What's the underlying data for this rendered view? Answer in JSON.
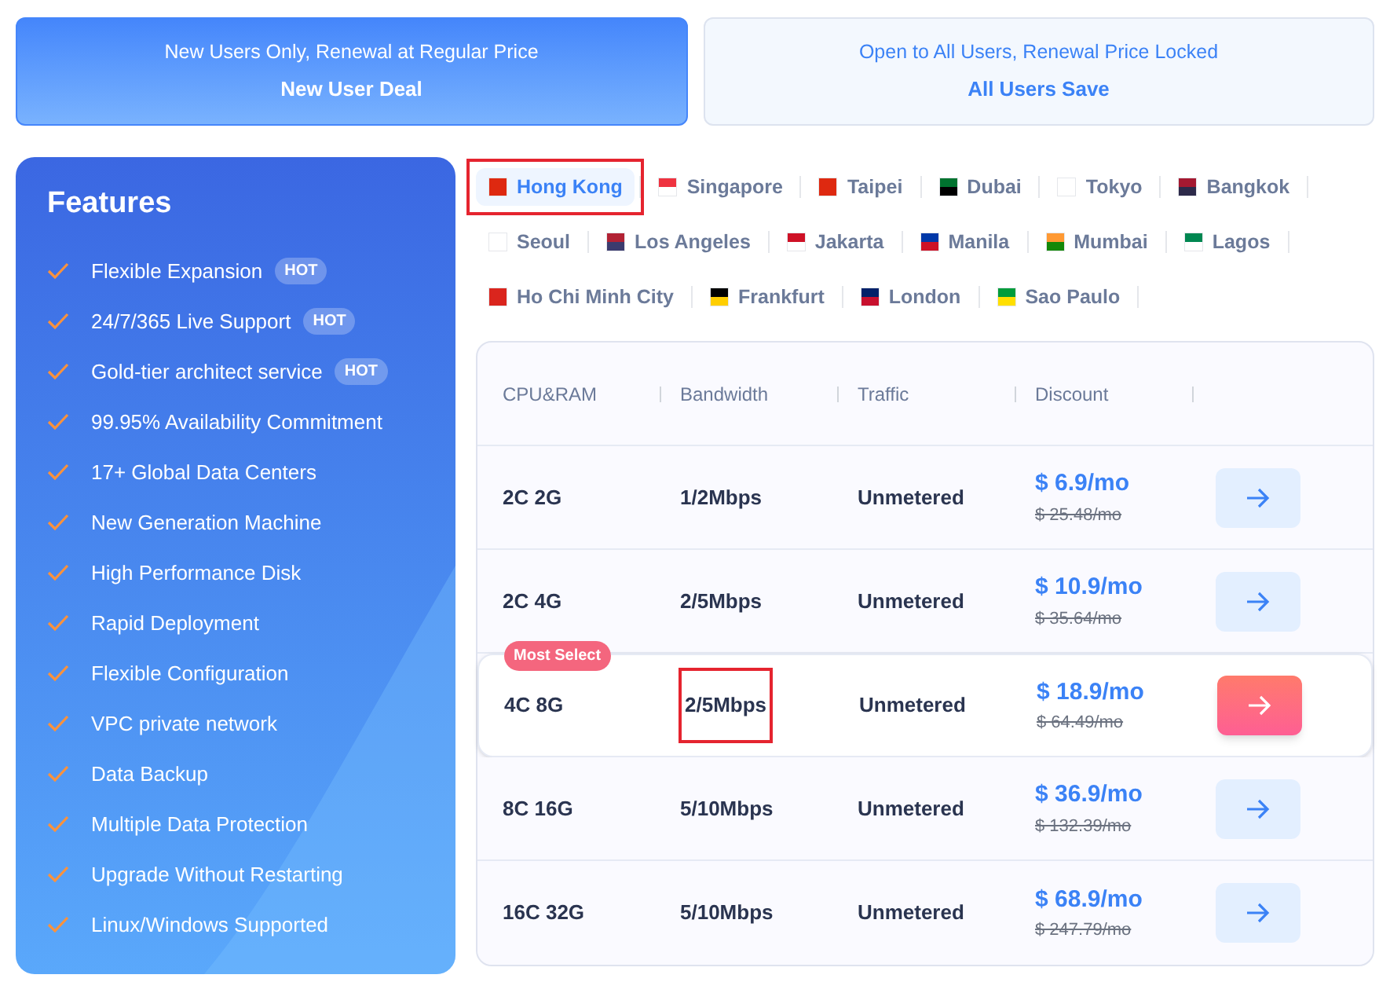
{
  "plan_tabs": [
    {
      "subtitle": "New Users Only, Renewal at Regular Price",
      "label": "New User Deal",
      "selected": true
    },
    {
      "subtitle": "Open to All Users, Renewal Price Locked",
      "label": "All Users Save",
      "selected": false
    }
  ],
  "features": {
    "title": "Features",
    "items": [
      {
        "label": "Flexible Expansion",
        "badge": "HOT"
      },
      {
        "label": "24/7/365 Live Support",
        "badge": "HOT"
      },
      {
        "label": "Gold-tier architect service",
        "badge": "HOT"
      },
      {
        "label": "99.95% Availability Commitment"
      },
      {
        "label": "17+ Global Data Centers"
      },
      {
        "label": "New Generation Machine"
      },
      {
        "label": "High Performance Disk"
      },
      {
        "label": "Rapid Deployment"
      },
      {
        "label": "Flexible Configuration"
      },
      {
        "label": "VPC private network"
      },
      {
        "label": "Data Backup"
      },
      {
        "label": "Multiple Data Protection"
      },
      {
        "label": "Upgrade Without Restarting"
      },
      {
        "label": "Linux/Windows Supported"
      }
    ]
  },
  "regions": [
    {
      "label": "Hong Kong",
      "selected": true,
      "annotated": true
    },
    {
      "label": "Singapore",
      "selected": false,
      "annotated": false
    },
    {
      "label": "Taipei",
      "selected": false,
      "annotated": false
    },
    {
      "label": "Dubai",
      "selected": false,
      "annotated": false
    },
    {
      "label": "Tokyo",
      "selected": false,
      "annotated": false
    },
    {
      "label": "Bangkok",
      "selected": false,
      "annotated": false
    },
    {
      "label": "Seoul",
      "selected": false,
      "annotated": false
    },
    {
      "label": "Los Angeles",
      "selected": false,
      "annotated": false
    },
    {
      "label": "Jakarta",
      "selected": false,
      "annotated": false
    },
    {
      "label": "Manila",
      "selected": false,
      "annotated": false
    },
    {
      "label": "Mumbai",
      "selected": false,
      "annotated": false
    },
    {
      "label": "Lagos",
      "selected": false,
      "annotated": false
    },
    {
      "label": "Ho Chi Minh City",
      "selected": false,
      "annotated": false
    },
    {
      "label": "Frankfurt",
      "selected": false,
      "annotated": false
    },
    {
      "label": "London",
      "selected": false,
      "annotated": false
    },
    {
      "label": "Sao Paulo",
      "selected": false,
      "annotated": false
    }
  ],
  "table": {
    "columns": [
      "CPU&RAM",
      "Bandwidth",
      "Traffic",
      "Discount"
    ],
    "rows": [
      {
        "cpu_ram": "2C 2G",
        "bandwidth": "1/2Mbps",
        "traffic": "Unmetered",
        "price": "$ 6.9/mo",
        "old_price": "$ 25.48/mo",
        "featured": false,
        "bandwidth_annotated": false
      },
      {
        "cpu_ram": "2C 4G",
        "bandwidth": "2/5Mbps",
        "traffic": "Unmetered",
        "price": "$ 10.9/mo",
        "old_price": "$ 35.64/mo",
        "featured": false,
        "bandwidth_annotated": false
      },
      {
        "cpu_ram": "4C 8G",
        "bandwidth": "2/5Mbps",
        "traffic": "Unmetered",
        "price": "$ 18.9/mo",
        "old_price": "$ 64.49/mo",
        "featured": true,
        "badge": "Most Select",
        "bandwidth_annotated": true
      },
      {
        "cpu_ram": "8C 16G",
        "bandwidth": "5/10Mbps",
        "traffic": "Unmetered",
        "price": "$ 36.9/mo",
        "old_price": "$ 132.39/mo",
        "featured": false,
        "bandwidth_annotated": false
      },
      {
        "cpu_ram": "16C 32G",
        "bandwidth": "5/10Mbps",
        "traffic": "Unmetered",
        "price": "$ 68.9/mo",
        "old_price": "$ 247.79/mo",
        "featured": false,
        "bandwidth_annotated": false
      }
    ]
  }
}
